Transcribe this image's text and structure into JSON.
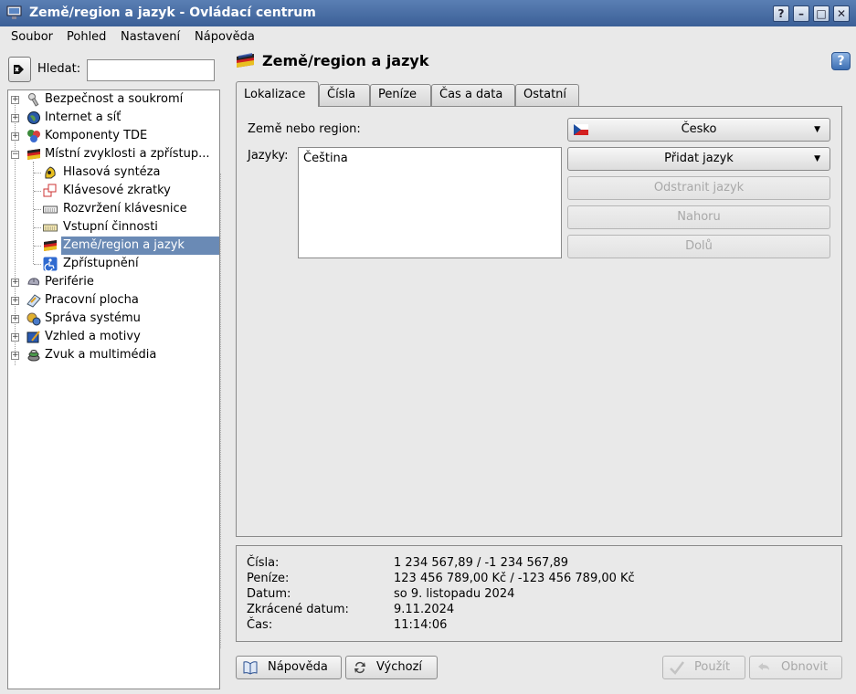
{
  "window": {
    "title": "Země/region a jazyk - Ovládací centrum",
    "buttons": [
      "?",
      "–",
      "□",
      "✕"
    ]
  },
  "menu": [
    "Soubor",
    "Pohled",
    "Nastavení",
    "Nápověda"
  ],
  "sidebar": {
    "search_label": "Hledat:",
    "search_value": "",
    "items": [
      {
        "label": "Bezpečnost a soukromí",
        "icon": "security-icon"
      },
      {
        "label": "Internet a síť",
        "icon": "globe-icon"
      },
      {
        "label": "Komponenty TDE",
        "icon": "components-icon"
      },
      {
        "label": "Místní zvyklosti a zpřístup...",
        "icon": "locale-flag-icon"
      },
      {
        "label": "Hlasová syntéza",
        "icon": "speech-icon"
      },
      {
        "label": "Klávesové zkratky",
        "icon": "shortcuts-icon"
      },
      {
        "label": "Rozvržení klávesnice",
        "icon": "keyboard-icon"
      },
      {
        "label": "Vstupní činnosti",
        "icon": "input-actions-icon"
      },
      {
        "label": "Země/region a jazyk",
        "icon": "country-flag-icon"
      },
      {
        "label": "Zpřístupnění",
        "icon": "accessibility-icon"
      },
      {
        "label": "Periférie",
        "icon": "peripherals-icon"
      },
      {
        "label": "Pracovní plocha",
        "icon": "desktop-icon"
      },
      {
        "label": "Správa systému",
        "icon": "system-admin-icon"
      },
      {
        "label": "Vzhled a motivy",
        "icon": "appearance-icon"
      },
      {
        "label": "Zvuk a multimédia",
        "icon": "sound-icon"
      }
    ]
  },
  "module": {
    "title": "Země/region a jazyk",
    "tabs": [
      "Lokalizace",
      "Čísla",
      "Peníze",
      "Čas a data",
      "Ostatní"
    ],
    "active_tab": "Lokalizace",
    "country_label": "Země nebo region:",
    "country_value": "Česko",
    "languages_label": "Jazyky:",
    "languages": [
      "Čeština"
    ],
    "add_language": "Přidat jazyk",
    "remove_language": "Odstranit jazyk",
    "move_up": "Nahoru",
    "move_down": "Dolů"
  },
  "preview": {
    "rows": [
      {
        "key": "Čísla:",
        "value": "1 234 567,89 / -1 234 567,89"
      },
      {
        "key": "Peníze:",
        "value": "123 456 789,00 Kč / -123 456 789,00 Kč"
      },
      {
        "key": "Datum:",
        "value": "so 9. listopadu 2024"
      },
      {
        "key": "Zkrácené datum:",
        "value": "9.11.2024"
      },
      {
        "key": "Čas:",
        "value": "11:14:06"
      }
    ]
  },
  "footer": {
    "help": "Nápověda",
    "defaults": "Výchozí",
    "apply": "Použít",
    "reset": "Obnovit"
  },
  "colors": {
    "titlebar": "#4a6fa7",
    "selection": "#6a8ab5",
    "background": "#e9e9e9"
  }
}
